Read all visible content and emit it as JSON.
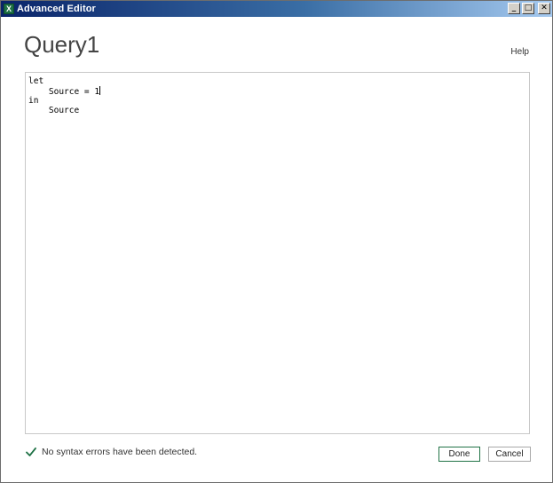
{
  "window": {
    "title": "Advanced Editor",
    "app_icon": "excel-icon",
    "app_icon_letter": "X",
    "controls": {
      "minimize": "minimize-icon",
      "maximize": "maximize-icon",
      "close": "close-icon",
      "minimize_glyph": "_",
      "maximize_glyph": "□",
      "close_glyph": "✕"
    }
  },
  "header": {
    "query_name": "Query1",
    "help_label": "Help"
  },
  "editor": {
    "lines": [
      "let",
      "    Source = 1",
      "in",
      "    Source"
    ]
  },
  "status": {
    "icon": "checkmark-icon",
    "message": "No syntax errors have been detected.",
    "color": "#1e7145"
  },
  "buttons": {
    "done_label": "Done",
    "cancel_label": "Cancel"
  },
  "colors": {
    "titlebar_start": "#0a246a",
    "accent_green": "#217346"
  }
}
